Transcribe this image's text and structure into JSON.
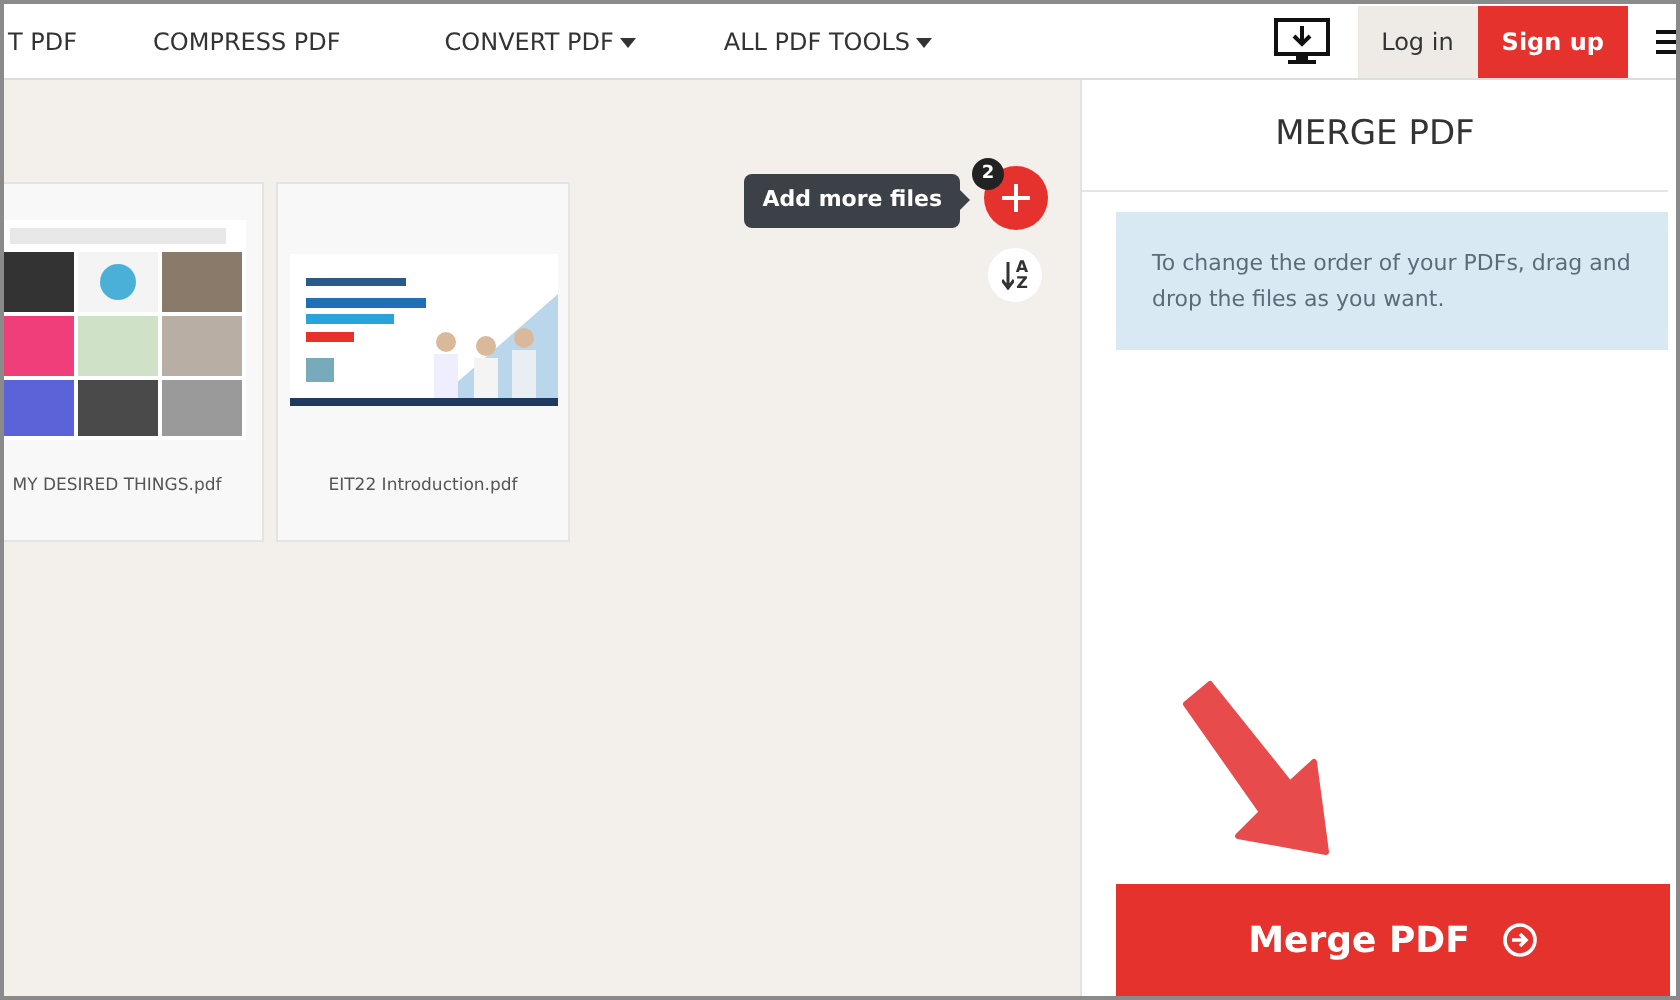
{
  "nav": {
    "links": [
      {
        "label": "T PDF",
        "dropdown": false
      },
      {
        "label": "COMPRESS PDF",
        "dropdown": false
      },
      {
        "label": "CONVERT PDF",
        "dropdown": true
      },
      {
        "label": "ALL PDF TOOLS",
        "dropdown": true
      }
    ],
    "login": "Log in",
    "signup": "Sign up"
  },
  "files": [
    {
      "name": "MY DESIRED THINGS.pdf",
      "kind": "picture"
    },
    {
      "name": "EIT22 Introduction.pdf",
      "kind": "picture"
    }
  ],
  "add_files": {
    "tooltip": "Add more files",
    "count": "2"
  },
  "sort_letters": [
    "A",
    "Z"
  ],
  "panel": {
    "title": "MERGE PDF",
    "hint": "To change the order of your PDFs, drag and drop the files as you want.",
    "button": "Merge PDF"
  }
}
